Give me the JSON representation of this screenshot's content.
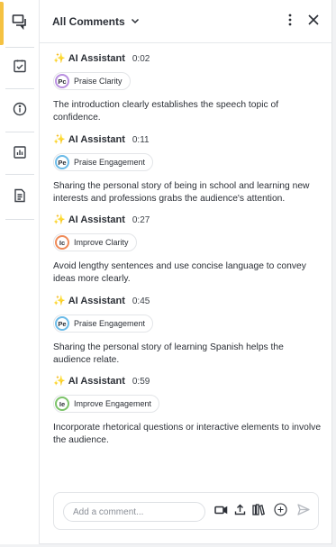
{
  "header": {
    "filter_label": "All Comments"
  },
  "rail": {
    "items": [
      {
        "icon": "comments-icon",
        "active": true
      },
      {
        "icon": "checklist-icon",
        "active": false
      },
      {
        "icon": "info-icon",
        "active": false
      },
      {
        "icon": "chart-icon",
        "active": false
      },
      {
        "icon": "document-icon",
        "active": false
      }
    ]
  },
  "comments": [
    {
      "author": "AI Assistant",
      "time": "0:02",
      "tag_initials": "Pc",
      "tag_label": "Praise Clarity",
      "tag_color": "#b98fe0",
      "text": "The introduction clearly establishes the speech topic of confidence."
    },
    {
      "author": "AI Assistant",
      "time": "0:11",
      "tag_initials": "Pe",
      "tag_label": "Praise Engagement",
      "tag_color": "#6bbbe8",
      "text": "Sharing the personal story of being in school and learning new interests and professions grabs the audience's attention."
    },
    {
      "author": "AI Assistant",
      "time": "0:27",
      "tag_initials": "Ic",
      "tag_label": "Improve Clarity",
      "tag_color": "#ef8a58",
      "text": "Avoid lengthy sentences and use concise language to convey ideas more clearly."
    },
    {
      "author": "AI Assistant",
      "time": "0:45",
      "tag_initials": "Pe",
      "tag_label": "Praise Engagement",
      "tag_color": "#6bbbe8",
      "text": "Sharing the personal story of learning Spanish helps the audience relate."
    },
    {
      "author": "AI Assistant",
      "time": "0:59",
      "tag_initials": "Ie",
      "tag_label": "Improve Engagement",
      "tag_color": "#7cc36a",
      "text": "Incorporate rhetorical questions or interactive elements to involve the audience."
    }
  ],
  "composer": {
    "placeholder": "Add a comment..."
  },
  "colors": {
    "active_accent": "#f5c242",
    "sparkle": "#f0b83a"
  }
}
